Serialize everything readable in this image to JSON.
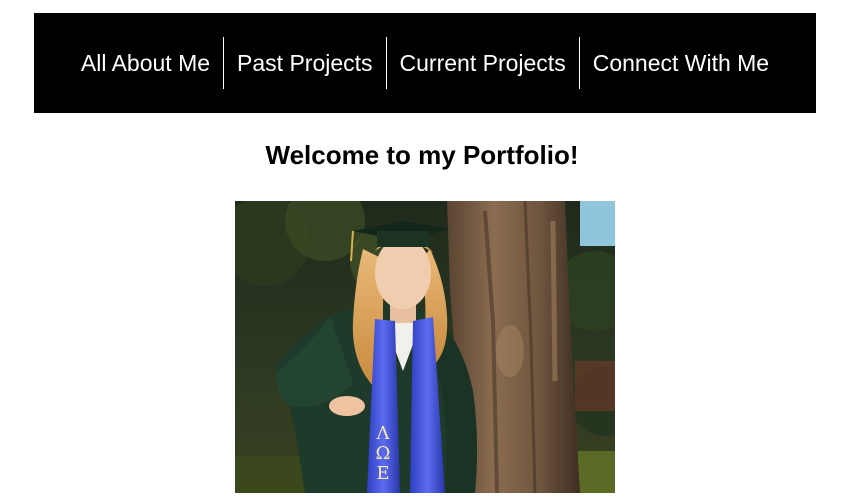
{
  "nav": {
    "items": [
      {
        "label": "All About Me"
      },
      {
        "label": "Past Projects"
      },
      {
        "label": "Current Projects"
      },
      {
        "label": "Connect With Me"
      }
    ]
  },
  "page": {
    "title": "Welcome to my Portfolio!"
  },
  "photo": {
    "stole_letters": [
      "Λ",
      "Ω",
      "Ε"
    ]
  },
  "colors": {
    "nav_bg": "#000000",
    "nav_text": "#ffffff",
    "gown": "#1e3a2a",
    "stole": "#3c4fd4"
  }
}
